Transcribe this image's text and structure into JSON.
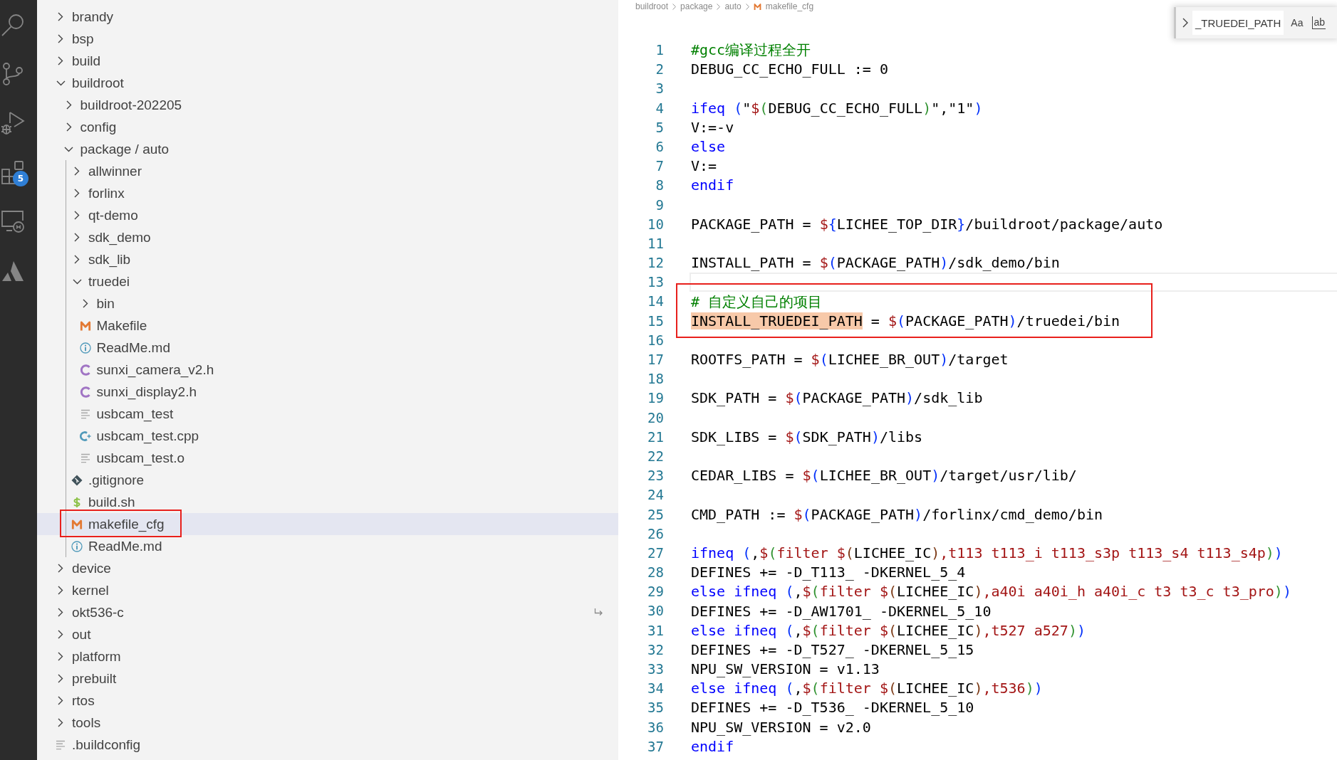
{
  "activity_bar": {
    "items": [
      {
        "kind": "search"
      },
      {
        "kind": "source-control"
      },
      {
        "kind": "run-debug"
      },
      {
        "kind": "extensions",
        "badge": "5"
      },
      {
        "kind": "remote"
      },
      {
        "kind": "atlassian"
      }
    ]
  },
  "explorer": {
    "tree": [
      {
        "label": "brandy",
        "kind": "folder",
        "expanded": false,
        "selected": false,
        "boxed": false
      },
      {
        "label": "bsp",
        "kind": "folder",
        "expanded": false,
        "selected": false,
        "boxed": false
      },
      {
        "label": "build",
        "kind": "folder",
        "expanded": false,
        "selected": false,
        "boxed": false
      },
      {
        "label": "buildroot",
        "kind": "folder",
        "expanded": true,
        "selected": false,
        "boxed": false,
        "children": [
          {
            "label": "buildroot-202205",
            "kind": "folder",
            "expanded": false,
            "selected": false,
            "boxed": false
          },
          {
            "label": "config",
            "kind": "folder",
            "expanded": false,
            "selected": false,
            "boxed": false
          },
          {
            "label": "package / auto",
            "kind": "folder",
            "expanded": true,
            "selected": false,
            "boxed": false,
            "children": [
              {
                "label": "allwinner",
                "kind": "folder",
                "expanded": false,
                "selected": false,
                "boxed": false
              },
              {
                "label": "forlinx",
                "kind": "folder",
                "expanded": false,
                "selected": false,
                "boxed": false
              },
              {
                "label": "qt-demo",
                "kind": "folder",
                "expanded": false,
                "selected": false,
                "boxed": false
              },
              {
                "label": "sdk_demo",
                "kind": "folder",
                "expanded": false,
                "selected": false,
                "boxed": false
              },
              {
                "label": "sdk_lib",
                "kind": "folder",
                "expanded": false,
                "selected": false,
                "boxed": false
              },
              {
                "label": "truedei",
                "kind": "folder",
                "expanded": true,
                "selected": false,
                "boxed": false,
                "children": [
                  {
                    "label": "bin",
                    "kind": "folder",
                    "expanded": false,
                    "selected": false,
                    "boxed": false
                  },
                  {
                    "label": "Makefile",
                    "kind": "makefile",
                    "selected": false,
                    "boxed": false
                  },
                  {
                    "label": "ReadMe.md",
                    "kind": "readme",
                    "selected": false,
                    "boxed": false
                  },
                  {
                    "label": "sunxi_camera_v2.h",
                    "kind": "c-header",
                    "selected": false,
                    "boxed": false
                  },
                  {
                    "label": "sunxi_display2.h",
                    "kind": "c-header",
                    "selected": false,
                    "boxed": false
                  },
                  {
                    "label": "usbcam_test",
                    "kind": "plain-text",
                    "selected": false,
                    "boxed": false
                  },
                  {
                    "label": "usbcam_test.cpp",
                    "kind": "cpp",
                    "selected": false,
                    "boxed": false
                  },
                  {
                    "label": "usbcam_test.o",
                    "kind": "plain-text",
                    "selected": false,
                    "boxed": false
                  }
                ]
              },
              {
                "label": ".gitignore",
                "kind": "git",
                "selected": false,
                "boxed": false
              },
              {
                "label": "build.sh",
                "kind": "shell",
                "selected": false,
                "boxed": false
              },
              {
                "label": "makefile_cfg",
                "kind": "makefile",
                "selected": true,
                "boxed": true
              },
              {
                "label": "ReadMe.md",
                "kind": "readme",
                "selected": false,
                "boxed": false
              }
            ]
          }
        ]
      },
      {
        "label": "device",
        "kind": "folder",
        "expanded": false,
        "selected": false,
        "boxed": false
      },
      {
        "label": "kernel",
        "kind": "folder",
        "expanded": false,
        "selected": false,
        "boxed": false
      },
      {
        "label": "okt536-c",
        "kind": "folder",
        "expanded": false,
        "selected": false,
        "boxed": false
      },
      {
        "label": "out",
        "kind": "folder",
        "expanded": false,
        "selected": false,
        "boxed": false
      },
      {
        "label": "platform",
        "kind": "folder",
        "expanded": false,
        "selected": false,
        "boxed": false
      },
      {
        "label": "prebuilt",
        "kind": "folder",
        "expanded": false,
        "selected": false,
        "boxed": false
      },
      {
        "label": "rtos",
        "kind": "folder",
        "expanded": false,
        "selected": false,
        "boxed": false
      },
      {
        "label": "tools",
        "kind": "folder",
        "expanded": false,
        "selected": false,
        "boxed": false
      },
      {
        "label": ".buildconfig",
        "kind": "plain-text",
        "selected": false,
        "boxed": false
      }
    ]
  },
  "editor": {
    "breadcrumbs": [
      {
        "label": "buildroot",
        "kind": "folder"
      },
      {
        "label": "package",
        "kind": "folder"
      },
      {
        "label": "auto",
        "kind": "folder"
      },
      {
        "label": "makefile_cfg",
        "kind": "makefile"
      }
    ],
    "find_widget": {
      "value": "_TRUEDEI_PATH",
      "options": [
        {
          "label": "Aa",
          "kind": "match-case",
          "selected": false
        },
        {
          "label": "ab",
          "kind": "whole-word",
          "selected": false
        }
      ]
    },
    "lines": [
      {
        "number": "1",
        "current": false,
        "boxed": false,
        "tokens": [
          {
            "kind": "comment",
            "text": "#gcc编译过程全开"
          }
        ]
      },
      {
        "number": "2",
        "current": false,
        "boxed": false,
        "tokens": [
          {
            "kind": "plain",
            "text": "DEBUG_CC_ECHO_FULL := 0"
          }
        ]
      },
      {
        "number": "3",
        "current": false,
        "boxed": false
      },
      {
        "number": "4",
        "current": false,
        "boxed": false,
        "tokens": [
          {
            "kind": "keyword",
            "text": "ifeq "
          },
          {
            "kind": "bracket1",
            "text": "("
          },
          {
            "kind": "plain",
            "text": "\""
          },
          {
            "kind": "builtin",
            "text": "$"
          },
          {
            "kind": "bracket2",
            "text": "("
          },
          {
            "kind": "plain",
            "text": "DEBUG_CC_ECHO_FULL"
          },
          {
            "kind": "bracket2",
            "text": ")"
          },
          {
            "kind": "plain",
            "text": "\",\"1\""
          },
          {
            "kind": "bracket1",
            "text": ")"
          }
        ]
      },
      {
        "number": "5",
        "current": false,
        "boxed": false,
        "tokens": [
          {
            "kind": "plain",
            "text": "V:=-v"
          }
        ]
      },
      {
        "number": "6",
        "current": false,
        "boxed": false,
        "tokens": [
          {
            "kind": "keyword",
            "text": "else"
          }
        ]
      },
      {
        "number": "7",
        "current": false,
        "boxed": false,
        "tokens": [
          {
            "kind": "plain",
            "text": "V:="
          }
        ]
      },
      {
        "number": "8",
        "current": false,
        "boxed": false,
        "tokens": [
          {
            "kind": "keyword",
            "text": "endif"
          }
        ]
      },
      {
        "number": "9",
        "current": false,
        "boxed": false
      },
      {
        "number": "10",
        "current": false,
        "boxed": false,
        "tokens": [
          {
            "kind": "plain",
            "text": "PACKAGE_PATH = "
          },
          {
            "kind": "builtin",
            "text": "$"
          },
          {
            "kind": "bracket1",
            "text": "{"
          },
          {
            "kind": "plain",
            "text": "LICHEE_TOP_DIR"
          },
          {
            "kind": "bracket1",
            "text": "}"
          },
          {
            "kind": "plain",
            "text": "/buildroot/package/auto"
          }
        ]
      },
      {
        "number": "11",
        "current": false,
        "boxed": false
      },
      {
        "number": "12",
        "current": false,
        "boxed": false,
        "tokens": [
          {
            "kind": "plain",
            "text": "INSTALL_PATH = "
          },
          {
            "kind": "builtin",
            "text": "$"
          },
          {
            "kind": "bracket1",
            "text": "("
          },
          {
            "kind": "plain",
            "text": "PACKAGE_PATH"
          },
          {
            "kind": "bracket1",
            "text": ")"
          },
          {
            "kind": "plain",
            "text": "/sdk_demo/bin"
          }
        ]
      },
      {
        "number": "13",
        "current": true,
        "boxed": false
      },
      {
        "number": "14",
        "current": false,
        "boxed": true,
        "tokens": [
          {
            "kind": "comment",
            "text": "# 自定义自己的项目"
          }
        ]
      },
      {
        "number": "15",
        "current": false,
        "boxed": true,
        "tokens": [
          {
            "kind": "match",
            "text": "INSTALL_TRUEDEI_PATH"
          },
          {
            "kind": "plain",
            "text": " = "
          },
          {
            "kind": "builtin",
            "text": "$"
          },
          {
            "kind": "bracket1",
            "text": "("
          },
          {
            "kind": "plain",
            "text": "PACKAGE_PATH"
          },
          {
            "kind": "bracket1",
            "text": ")"
          },
          {
            "kind": "plain",
            "text": "/truedei/bin"
          }
        ]
      },
      {
        "number": "16",
        "current": false,
        "boxed": false
      },
      {
        "number": "17",
        "current": false,
        "boxed": false,
        "tokens": [
          {
            "kind": "plain",
            "text": "ROOTFS_PATH = "
          },
          {
            "kind": "builtin",
            "text": "$"
          },
          {
            "kind": "bracket1",
            "text": "("
          },
          {
            "kind": "plain",
            "text": "LICHEE_BR_OUT"
          },
          {
            "kind": "bracket1",
            "text": ")"
          },
          {
            "kind": "plain",
            "text": "/target"
          }
        ]
      },
      {
        "number": "18",
        "current": false,
        "boxed": false
      },
      {
        "number": "19",
        "current": false,
        "boxed": false,
        "tokens": [
          {
            "kind": "plain",
            "text": "SDK_PATH = "
          },
          {
            "kind": "builtin",
            "text": "$"
          },
          {
            "kind": "bracket1",
            "text": "("
          },
          {
            "kind": "plain",
            "text": "PACKAGE_PATH"
          },
          {
            "kind": "bracket1",
            "text": ")"
          },
          {
            "kind": "plain",
            "text": "/sdk_lib"
          }
        ]
      },
      {
        "number": "20",
        "current": false,
        "boxed": false
      },
      {
        "number": "21",
        "current": false,
        "boxed": false,
        "tokens": [
          {
            "kind": "plain",
            "text": "SDK_LIBS = "
          },
          {
            "kind": "builtin",
            "text": "$"
          },
          {
            "kind": "bracket1",
            "text": "("
          },
          {
            "kind": "plain",
            "text": "SDK_PATH"
          },
          {
            "kind": "bracket1",
            "text": ")"
          },
          {
            "kind": "plain",
            "text": "/libs"
          }
        ]
      },
      {
        "number": "22",
        "current": false,
        "boxed": false
      },
      {
        "number": "23",
        "current": false,
        "boxed": false,
        "tokens": [
          {
            "kind": "plain",
            "text": "CEDAR_LIBS = "
          },
          {
            "kind": "builtin",
            "text": "$"
          },
          {
            "kind": "bracket1",
            "text": "("
          },
          {
            "kind": "plain",
            "text": "LICHEE_BR_OUT"
          },
          {
            "kind": "bracket1",
            "text": ")"
          },
          {
            "kind": "plain",
            "text": "/target/usr/lib/"
          }
        ]
      },
      {
        "number": "24",
        "current": false,
        "boxed": false
      },
      {
        "number": "25",
        "current": false,
        "boxed": false,
        "tokens": [
          {
            "kind": "plain",
            "text": "CMD_PATH := "
          },
          {
            "kind": "builtin",
            "text": "$"
          },
          {
            "kind": "bracket1",
            "text": "("
          },
          {
            "kind": "plain",
            "text": "PACKAGE_PATH"
          },
          {
            "kind": "bracket1",
            "text": ")"
          },
          {
            "kind": "plain",
            "text": "/forlinx/cmd_demo/bin"
          }
        ]
      },
      {
        "number": "26",
        "current": false,
        "boxed": false
      },
      {
        "number": "27",
        "current": false,
        "boxed": false,
        "tokens": [
          {
            "kind": "keyword",
            "text": "ifneq "
          },
          {
            "kind": "bracket1",
            "text": "("
          },
          {
            "kind": "plain",
            "text": ","
          },
          {
            "kind": "builtin",
            "text": "$"
          },
          {
            "kind": "bracket2",
            "text": "("
          },
          {
            "kind": "builtin",
            "text": "filter "
          },
          {
            "kind": "builtin",
            "text": "$"
          },
          {
            "kind": "bracket3",
            "text": "("
          },
          {
            "kind": "plain",
            "text": "LICHEE_IC"
          },
          {
            "kind": "bracket3",
            "text": ")"
          },
          {
            "kind": "builtin",
            "text": ",t113 t113_i t113_s3p t113_s4 t113_s4p"
          },
          {
            "kind": "bracket2",
            "text": ")"
          },
          {
            "kind": "bracket1",
            "text": ")"
          }
        ]
      },
      {
        "number": "28",
        "current": false,
        "boxed": false,
        "tokens": [
          {
            "kind": "plain",
            "text": "DEFINES += -D_T113_ -DKERNEL_5_4"
          }
        ]
      },
      {
        "number": "29",
        "current": false,
        "boxed": false,
        "tokens": [
          {
            "kind": "keyword",
            "text": "else ifneq "
          },
          {
            "kind": "bracket1",
            "text": "("
          },
          {
            "kind": "plain",
            "text": ","
          },
          {
            "kind": "builtin",
            "text": "$"
          },
          {
            "kind": "bracket2",
            "text": "("
          },
          {
            "kind": "builtin",
            "text": "filter "
          },
          {
            "kind": "builtin",
            "text": "$"
          },
          {
            "kind": "bracket3",
            "text": "("
          },
          {
            "kind": "plain",
            "text": "LICHEE_IC"
          },
          {
            "kind": "bracket3",
            "text": ")"
          },
          {
            "kind": "builtin",
            "text": ",a40i a40i_h a40i_c t3 t3_c t3_pro"
          },
          {
            "kind": "bracket2",
            "text": ")"
          },
          {
            "kind": "bracket1",
            "text": ")"
          }
        ]
      },
      {
        "number": "30",
        "current": false,
        "boxed": false,
        "tokens": [
          {
            "kind": "plain",
            "text": "DEFINES += -D_AW1701_ -DKERNEL_5_10"
          }
        ]
      },
      {
        "number": "31",
        "current": false,
        "boxed": false,
        "tokens": [
          {
            "kind": "keyword",
            "text": "else ifneq "
          },
          {
            "kind": "bracket1",
            "text": "("
          },
          {
            "kind": "plain",
            "text": ","
          },
          {
            "kind": "builtin",
            "text": "$"
          },
          {
            "kind": "bracket2",
            "text": "("
          },
          {
            "kind": "builtin",
            "text": "filter "
          },
          {
            "kind": "builtin",
            "text": "$"
          },
          {
            "kind": "bracket3",
            "text": "("
          },
          {
            "kind": "plain",
            "text": "LICHEE_IC"
          },
          {
            "kind": "bracket3",
            "text": ")"
          },
          {
            "kind": "builtin",
            "text": ",t527 a527"
          },
          {
            "kind": "bracket2",
            "text": ")"
          },
          {
            "kind": "bracket1",
            "text": ")"
          }
        ]
      },
      {
        "number": "32",
        "current": false,
        "boxed": false,
        "tokens": [
          {
            "kind": "plain",
            "text": "DEFINES += -D_T527_ -DKERNEL_5_15"
          }
        ]
      },
      {
        "number": "33",
        "current": false,
        "boxed": false,
        "tokens": [
          {
            "kind": "plain",
            "text": "NPU_SW_VERSION = v1.13"
          }
        ]
      },
      {
        "number": "34",
        "current": false,
        "boxed": false,
        "tokens": [
          {
            "kind": "keyword",
            "text": "else ifneq "
          },
          {
            "kind": "bracket1",
            "text": "("
          },
          {
            "kind": "plain",
            "text": ","
          },
          {
            "kind": "builtin",
            "text": "$"
          },
          {
            "kind": "bracket2",
            "text": "("
          },
          {
            "kind": "builtin",
            "text": "filter "
          },
          {
            "kind": "builtin",
            "text": "$"
          },
          {
            "kind": "bracket3",
            "text": "("
          },
          {
            "kind": "plain",
            "text": "LICHEE_IC"
          },
          {
            "kind": "bracket3",
            "text": ")"
          },
          {
            "kind": "builtin",
            "text": ",t536"
          },
          {
            "kind": "bracket2",
            "text": ")"
          },
          {
            "kind": "bracket1",
            "text": ")"
          }
        ]
      },
      {
        "number": "35",
        "current": false,
        "boxed": false,
        "tokens": [
          {
            "kind": "plain",
            "text": "DEFINES += -D_T536_ -DKERNEL_5_10"
          }
        ]
      },
      {
        "number": "36",
        "current": false,
        "boxed": false,
        "tokens": [
          {
            "kind": "plain",
            "text": "NPU_SW_VERSION = v2.0"
          }
        ]
      },
      {
        "number": "37",
        "current": false,
        "boxed": false,
        "tokens": [
          {
            "kind": "keyword",
            "text": "endif"
          }
        ]
      }
    ]
  }
}
